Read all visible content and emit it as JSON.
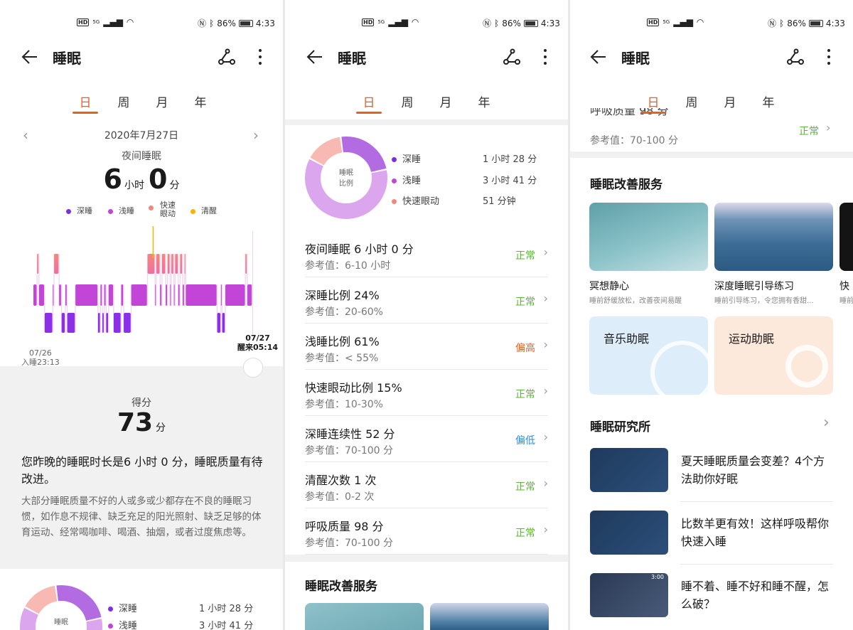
{
  "status": {
    "network": "5G",
    "battery": "86%",
    "time": "4:33"
  },
  "header": {
    "title": "睡眠"
  },
  "tabs": [
    "日",
    "周",
    "月",
    "年"
  ],
  "day": {
    "date": "2020年7月27日",
    "label": "夜间睡眠",
    "hours": "6",
    "hours_unit": "小时",
    "minutes": "0",
    "minutes_unit": "分"
  },
  "legend": [
    {
      "label": "深睡",
      "color": "#7b2fe0"
    },
    {
      "label": "浅睡",
      "color": "#c245d8"
    },
    {
      "label": "快速眼动",
      "color": "#f3877a"
    },
    {
      "label": "清醒",
      "color": "#f4b400"
    }
  ],
  "chart_data": {
    "type": "timeline",
    "title": "夜间睡眠",
    "start_label": "07/26",
    "start_time": "入睡23:13",
    "end_label": "07/27",
    "end_time": "醒来05:14",
    "stages": [
      "light",
      "rem",
      "light",
      "deep",
      "light",
      "rem",
      "light",
      "deep",
      "light",
      "deep",
      "light",
      "deep",
      "light",
      "deep",
      "light",
      "deep",
      "light",
      "deep",
      "light",
      "deep",
      "light",
      "rem",
      "light",
      "rem",
      "light",
      "rem",
      "light",
      "rem",
      "light",
      "rem",
      "light",
      "rem",
      "light",
      "rem",
      "light",
      "rem",
      "light",
      "deep",
      "light",
      "deep",
      "light",
      "rem",
      "light"
    ],
    "durations_min": [
      6,
      3,
      9,
      13,
      2,
      8,
      4,
      6,
      3,
      13,
      36,
      4,
      3,
      3,
      3,
      4,
      8,
      12,
      4,
      12,
      26,
      12,
      2,
      6,
      3,
      6,
      3,
      4,
      2,
      4,
      2,
      5,
      3,
      4,
      3,
      2,
      50,
      6,
      2,
      5,
      32,
      3,
      8
    ],
    "awake_at_min": 190
  },
  "score": {
    "label": "得分",
    "value": "73",
    "unit": "分",
    "summary": "您昨晚的睡眠时长是6 小时 0 分，睡眠质量有待改进。",
    "detail": "大部分睡眠质量不好的人或多或少都存在不良的睡眠习惯，如作息不规律、缺乏充足的阳光照射、缺乏足够的体育运动、经常喝咖啡、喝酒、抽烟，或者过度焦虑等。"
  },
  "donut": {
    "center": [
      "睡眠",
      "比例"
    ],
    "items": [
      {
        "label": "深睡",
        "value": "1 小时 28 分",
        "pct": 24,
        "color": "#b26be0"
      },
      {
        "label": "浅睡",
        "value": "3 小时 41 分",
        "pct": 61,
        "color": "#dca6ef"
      },
      {
        "label": "快速眼动",
        "value": "51 分钟",
        "pct": 15,
        "color": "#f7b9b2"
      }
    ]
  },
  "metrics": [
    {
      "title": "夜间睡眠  6 小时 0 分",
      "ref": "参考值：6-10 小时",
      "status": "正常",
      "color": "#5bb537"
    },
    {
      "title": "深睡比例  24%",
      "ref": "参考值：20-60%",
      "status": "正常",
      "color": "#5bb537"
    },
    {
      "title": "浅睡比例  61%",
      "ref": "参考值：< 55%",
      "status": "偏高",
      "color": "#e8611b"
    },
    {
      "title": "快速眼动比例  15%",
      "ref": "参考值：10-30%",
      "status": "正常",
      "color": "#5bb537"
    },
    {
      "title": "深睡连续性  52 分",
      "ref": "参考值：70-100 分",
      "status": "偏低",
      "color": "#2f8ee0"
    },
    {
      "title": "清醒次数  1 次",
      "ref": "参考值：0-2 次",
      "status": "正常",
      "color": "#5bb537"
    },
    {
      "title": "呼吸质量  98 分",
      "ref": "参考值：70-100 分",
      "status": "正常",
      "color": "#5bb537"
    }
  ],
  "services": {
    "title": "睡眠改善服务",
    "items": [
      {
        "title": "冥想静心",
        "sub": "睡前舒缓放松，改善夜间易醒"
      },
      {
        "title": "深度睡眠引导练习",
        "sub": "睡前引导练习，令您拥有香甜..."
      },
      {
        "title": "快",
        "sub": "睡前"
      }
    ],
    "cards": [
      "音乐助眠",
      "运动助眠"
    ]
  },
  "research": {
    "title": "睡眠研究所",
    "articles": [
      "夏天睡眠质量会变差？4个方法助你好眠",
      "比数羊更有效！这样呼吸帮你快速入睡",
      "睡不着、睡不好和睡不醒，怎么破？"
    ],
    "thumb_time": "3:00"
  }
}
